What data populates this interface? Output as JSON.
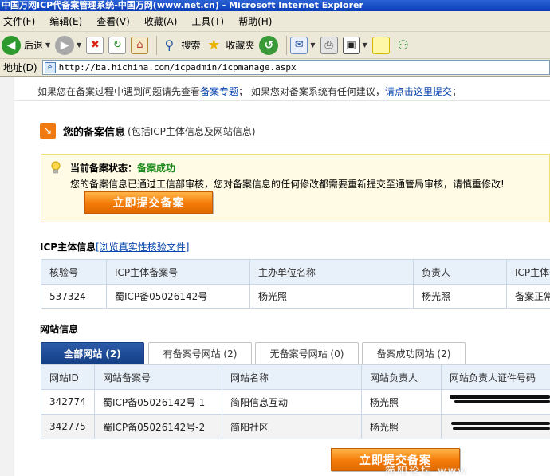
{
  "window": {
    "title": "中国万网ICP代备案管理系统-中国万网(www.net.cn) - Microsoft Internet Explorer"
  },
  "menu": [
    "文件(F)",
    "编辑(E)",
    "查看(V)",
    "收藏(A)",
    "工具(T)",
    "帮助(H)"
  ],
  "toolbar": {
    "back_label": "后退",
    "search_label": "搜索",
    "favorites_label": "收藏夹"
  },
  "address": {
    "label": "地址(D)",
    "url": "http://ba.hichina.com/icpadmin/icpmanage.aspx"
  },
  "notice": {
    "text1": "如果您在备案过程中遇到问题请先查看",
    "link1": "备案专题",
    "text2": "；  如果您对备案系统有任何建议，",
    "link2": "请点击这里提交",
    "text3": "；"
  },
  "section": {
    "title": "您的备案信息",
    "subtitle": "(包括ICP主体信息及网站信息)"
  },
  "status": {
    "label": "当前备案状态：",
    "value": "备案成功",
    "message": "您的备案信息已通过工信部审核，您对备案信息的任何修改都需要重新提交至通管局审核，请慎重修改!",
    "button": "立即提交备案"
  },
  "icp": {
    "title": "ICP主体信息",
    "link": "[浏览真实性核验文件]",
    "headers": [
      "核验号",
      "ICP主体备案号",
      "主办单位名称",
      "负责人",
      "ICP主体备"
    ],
    "rows": [
      [
        "537324",
        "蜀ICP备05026142号",
        "杨光照",
        "杨光照",
        "备案正常"
      ]
    ]
  },
  "sites": {
    "title": "网站信息",
    "tabs": [
      "全部网站 (2)",
      "有备案号网站 (2)",
      "无备案号网站 (0)",
      "备案成功网站 (2)"
    ],
    "headers": [
      "网站ID",
      "网站备案号",
      "网站名称",
      "网站负责人",
      "网站负责人证件号码"
    ],
    "rows": [
      [
        "342774",
        "蜀ICP备05026142号-1",
        "简阳信息互动",
        "杨光照",
        ""
      ],
      [
        "342775",
        "蜀ICP备05026142号-2",
        "简阳社区",
        "杨光照",
        ""
      ]
    ]
  },
  "bottom_button": "立即提交备案",
  "watermark": "简阳论坛  www",
  "colors": {
    "accent_orange": "#f47a08",
    "tab_active_blue": "#1d4a95",
    "link_blue": "#0645ad",
    "success_green": "#1a8a1a"
  }
}
